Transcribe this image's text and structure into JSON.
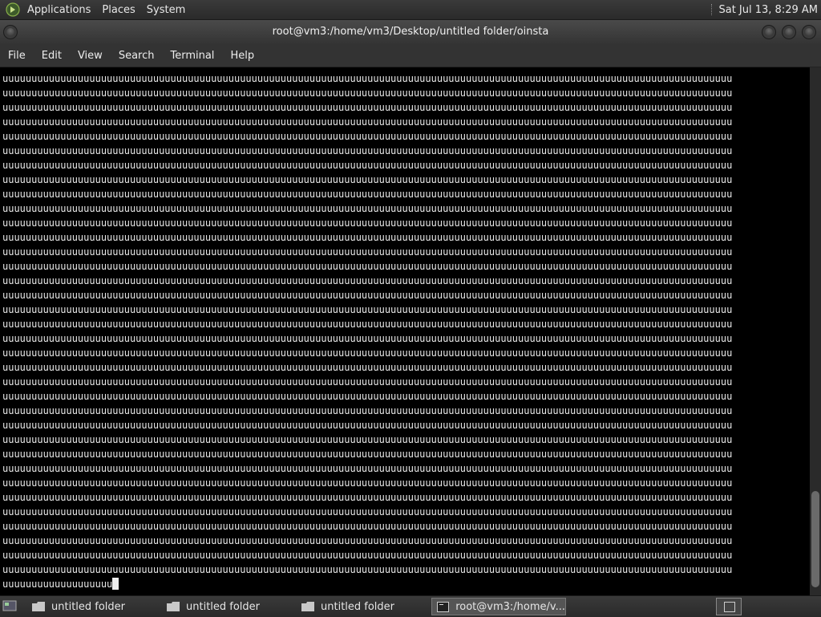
{
  "top_panel": {
    "menus": [
      "Applications",
      "Places",
      "System"
    ],
    "clock": "Sat Jul 13,  8:29 AM"
  },
  "window": {
    "title": "root@vm3:/home/vm3/Desktop/untitled folder/oinsta"
  },
  "menubar": [
    "File",
    "Edit",
    "View",
    "Search",
    "Terminal",
    "Help"
  ],
  "terminal": {
    "repeated_line": "uuuuuuuuuuuuuuuuuuuuuuuuuuuuuuuuuuuuuuuuuuuuuuuuuuuuuuuuuuuuuuuuuuuuuuuuuuuuuuuuuuuuuuuuuuuuuuuuuuuuuuuuuuuuuuuuuuuuuuuuuuuuuu",
    "full_line_count": 35,
    "last_line": "uuuuuuuuuuuuuuuuuuu"
  },
  "taskbar": {
    "items": [
      {
        "label": "untitled folder",
        "icon": "folder-icon"
      },
      {
        "label": "untitled folder",
        "icon": "folder-icon"
      },
      {
        "label": "untitled folder",
        "icon": "folder-icon"
      },
      {
        "label": "root@vm3:/home/v...",
        "icon": "terminal-icon"
      }
    ]
  },
  "colors": {
    "terminal_bg": "#000000",
    "terminal_fg": "#e8e8e8",
    "panel_bg": "#333333"
  }
}
